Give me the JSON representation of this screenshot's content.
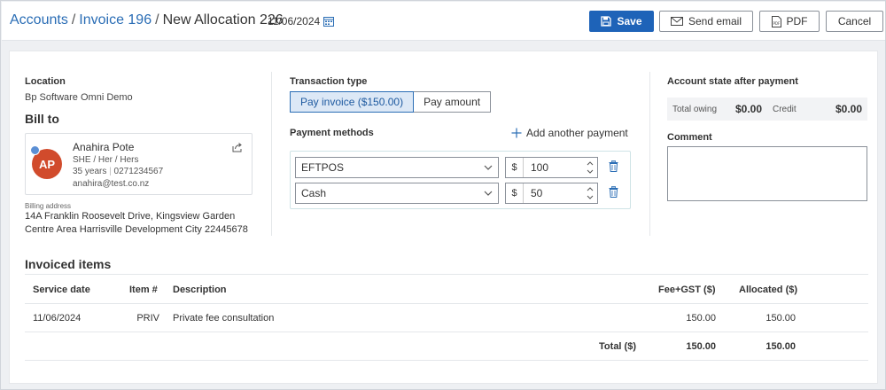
{
  "header": {
    "breadcrumb": [
      "Accounts",
      "Invoice 196",
      "New Allocation 226"
    ],
    "date": "11/06/2024",
    "save_label": "Save",
    "send_email_label": "Send email",
    "pdf_label": "PDF",
    "cancel_label": "Cancel"
  },
  "location": {
    "label": "Location",
    "value": "Bp Software Omni Demo"
  },
  "bill_to": {
    "title": "Bill to",
    "initials": "AP",
    "name": "Anahira Pote",
    "pronouns": "SHE / Her / Hers",
    "age": "35 years",
    "phone": "0271234567",
    "email": "anahira@test.co.nz",
    "billing_label": "Billing address",
    "address_line1": "14A Franklin Roosevelt Drive, Kingsview Garden",
    "address_line2": "Centre Area Harrisville Development City 22445678"
  },
  "transaction": {
    "label": "Transaction type",
    "options": [
      "Pay invoice ($150.00)",
      "Pay amount"
    ],
    "selected": 0
  },
  "payment_methods": {
    "label": "Payment methods",
    "add_label": "Add another payment",
    "rows": [
      {
        "method": "EFTPOS",
        "currency": "$",
        "amount": "100"
      },
      {
        "method": "Cash",
        "currency": "$",
        "amount": "50"
      }
    ]
  },
  "account_state": {
    "title": "Account state after payment",
    "total_owing_label": "Total owing",
    "total_owing": "$0.00",
    "credit_label": "Credit",
    "credit": "$0.00"
  },
  "comment": {
    "label": "Comment",
    "value": ""
  },
  "invoiced_items": {
    "title": "Invoiced items",
    "columns": [
      "Service date",
      "Item #",
      "Description",
      "Fee+GST ($)",
      "Allocated ($)"
    ],
    "rows": [
      {
        "date": "11/06/2024",
        "item": "PRIV",
        "description": "Private fee consultation",
        "fee": "150.00",
        "allocated": "150.00"
      }
    ],
    "total_label": "Total ($)",
    "total_fee": "150.00",
    "total_allocated": "150.00"
  },
  "colors": {
    "accent": "#1e63b8",
    "link": "#2a6db5",
    "avatar": "#d14b2c"
  }
}
